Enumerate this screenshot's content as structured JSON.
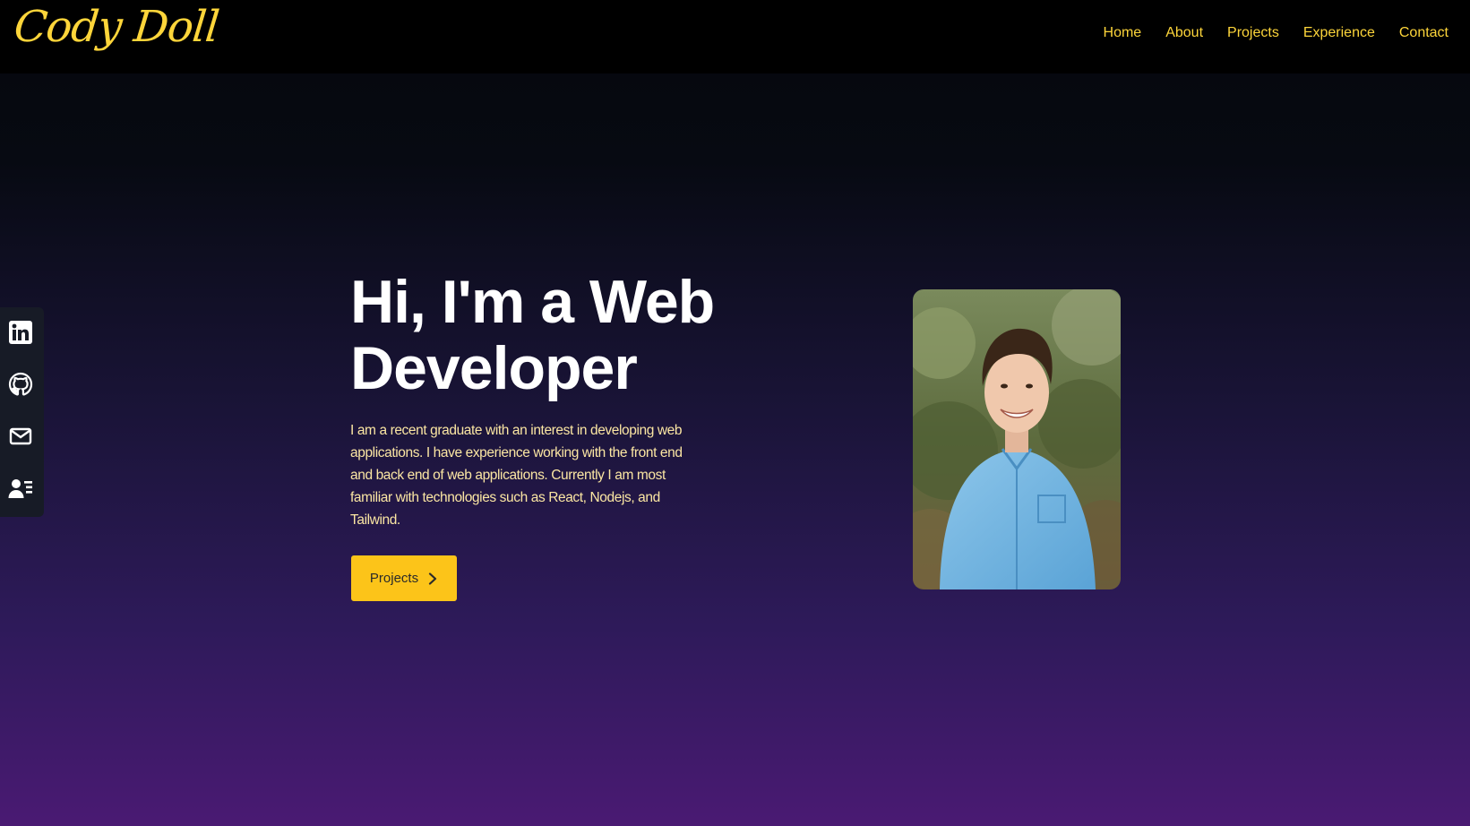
{
  "brand": {
    "logo_text": "Cody Doll",
    "accent_color": "#fdd53a"
  },
  "nav": {
    "items": [
      "Home",
      "About",
      "Projects",
      "Experience",
      "Contact"
    ]
  },
  "social": {
    "items": [
      {
        "name": "linkedin",
        "icon": "linkedin-icon"
      },
      {
        "name": "github",
        "icon": "github-icon"
      },
      {
        "name": "email",
        "icon": "mail-icon"
      },
      {
        "name": "resume",
        "icon": "resume-icon"
      }
    ]
  },
  "hero": {
    "title": "Hi, I'm a Web Developer",
    "description": "I am a recent graduate with an interest in developing web applications. I have experience working with the front end and back end of web applications. Currently I am most familiar with technologies such as React, Nodejs, and Tailwind.",
    "button_label": "Projects",
    "button_color": "#fcc419",
    "button_icon": "chevron-right-icon"
  },
  "portrait": {
    "subject": "headshot photo"
  }
}
